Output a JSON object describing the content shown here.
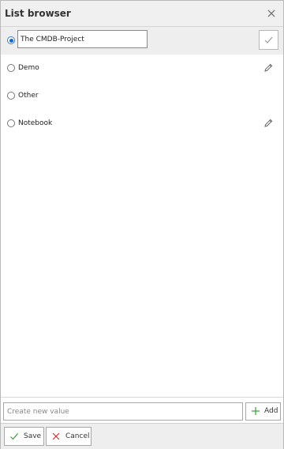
{
  "window": {
    "title": "List browser"
  },
  "list": {
    "editing_value": "The CMDB-Project",
    "items": [
      {
        "label": "The CMDB-Project",
        "selected": true,
        "editing": true
      },
      {
        "label": "Demo",
        "selected": false,
        "editable": true
      },
      {
        "label": "Other",
        "selected": false,
        "editable": false
      },
      {
        "label": "Notebook",
        "selected": false,
        "editable": true
      }
    ]
  },
  "add_bar": {
    "placeholder": "Create new value",
    "add_label": "Add"
  },
  "footer": {
    "save_label": "Save",
    "cancel_label": "Cancel"
  },
  "colors": {
    "accent": "#1a65c8",
    "confirm_check": "#9a9a9a",
    "add_plus": "#3aa03a",
    "save_check": "#3aa03a",
    "cancel_x": "#d23030"
  },
  "icons": {
    "close": "close-icon",
    "confirm": "checkmark-icon",
    "edit": "pencil-icon",
    "add": "plus-icon",
    "save": "checkmark-icon",
    "cancel": "x-icon"
  }
}
